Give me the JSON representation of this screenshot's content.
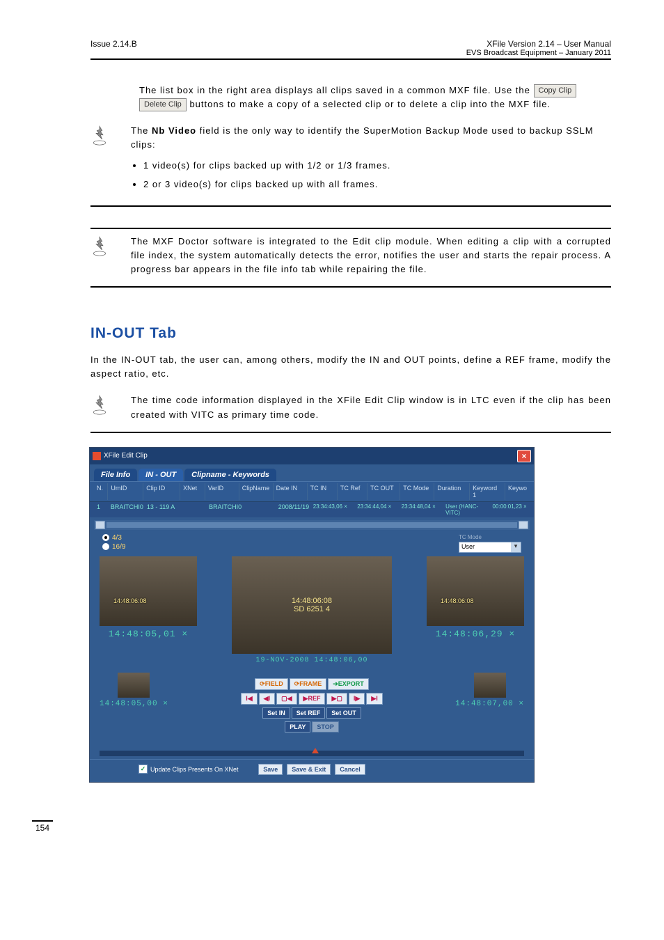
{
  "header": {
    "left": "Issue 2.14.B",
    "right_line1": "XFile Version 2.14 – User Manual",
    "right_line2": "EVS Broadcast Equipment – January 2011"
  },
  "intro": {
    "part1": "The list box in the right area displays all clips saved in a common MXF file. Use the ",
    "button1": "Copy Clip",
    "button2": "Delete Clip",
    "part2": " buttons to make a copy of a selected clip or to delete a clip into the MXF file."
  },
  "note1": {
    "sentence": "The Nb Video field is the only way to identify the SuperMotion Backup Mode used to backup SSLM clips:",
    "bold_span": "Nb Video",
    "bullet1": "1 video(s) for clips backed up with 1/2 or 1/3 frames.",
    "bullet2": "2 or 3 video(s) for clips backed up with all frames."
  },
  "note2": {
    "text": "The MXF Doctor software is integrated to the Edit clip module. When editing a clip with a corrupted file index, the system automatically detects the error, notifies the user and starts the repair process. A progress bar appears in the file info tab while repairing the file."
  },
  "section_title": "IN-OUT Tab",
  "section_para": "In the IN-OUT tab, the user can, among others, modify the IN and OUT points, define a REF frame, modify the aspect ratio, etc.",
  "note3": {
    "text": "The time code information displayed in the XFile Edit Clip window is in LTC even if the clip has been created with VITC as primary time code."
  },
  "shot": {
    "title": "XFile Edit Clip",
    "tabs": [
      "File Info",
      "IN - OUT",
      "Clipname - Keywords"
    ],
    "active_tab_index": 1,
    "columns": [
      "N.",
      "UmID",
      "Clip ID",
      "XNet",
      "VarID",
      "ClipName",
      "Date IN",
      "TC IN",
      "TC Ref",
      "TC OUT",
      "TC Mode",
      "Duration",
      "Keyword 1",
      "Keywo"
    ],
    "row": {
      "n": "1",
      "umid": "BRAITCHI0",
      "clipid": "13 - 119 A",
      "xnet": "",
      "varid": "BRAITCHI0",
      "datein": "2008/11/19",
      "tcin": "23:34:43,06 ×",
      "tcref": "23:34:44,04 ×",
      "tcout": "23:34:48,04 ×",
      "tcmode": "User (HANC-VITC)",
      "duration": "00:00:01,23 ×"
    },
    "aspect": {
      "opt1": "4/3",
      "opt2": "16/9",
      "selected": 0
    },
    "tcmode_label": "TC Mode",
    "tcmode_combo": "User",
    "views": {
      "left_label": "14:48:05,01 ×",
      "center_overlay_line1": "14:48:06:08",
      "center_overlay_line2": "SD 6251  4",
      "center_bar": "19-NOV-2008 14:48:06,00",
      "right_label": "14:48:06,29 ×",
      "thumb_overlay": "14:48:06:08"
    },
    "bottom": {
      "left_tc": "14:48:05,00 ×",
      "right_tc": "14:48:07,00 ×",
      "field": "FIELD",
      "frame": "FRAME",
      "export": "EXPORT",
      "ref": "REF",
      "setin": "Set IN",
      "setref": "Set REF",
      "setout": "Set OUT",
      "play": "PLAY",
      "stop": "STOP"
    },
    "footer": {
      "update": "Update Clips Presents On XNet",
      "save": "Save",
      "saveexit": "Save & Exit",
      "cancel": "Cancel"
    }
  },
  "page_number": "154"
}
